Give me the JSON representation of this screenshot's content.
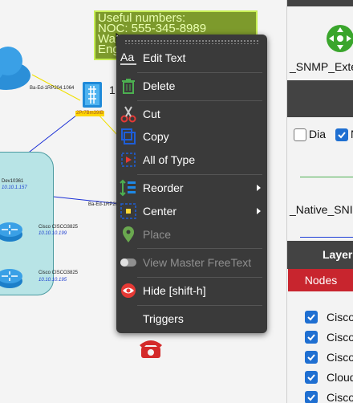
{
  "canvas": {
    "freetext_lines": [
      "Useful numbers:",
      "NOC: 555-345-8989",
      "Wa",
      "Eng"
    ],
    "nodes": [
      {
        "name": "Ba-Ed-1RP204.1064"
      },
      {
        "name": "2Pr7Bm39IB"
      },
      {
        "name": "Dev10361",
        "ip": "10.10.1.157"
      },
      {
        "name": "Ba-Ed-1RP20"
      },
      {
        "name": "Cisco CISCO3825",
        "ip": "10.10.10.199"
      },
      {
        "name": "Cisco CISCO3825",
        "ip": "10.10.10.195"
      }
    ],
    "partial_digit": "1"
  },
  "context_menu": {
    "items": [
      {
        "label": "Edit Text",
        "icon": "text-format-icon",
        "disabled": false
      },
      {
        "label": "Delete",
        "icon": "trash-icon",
        "disabled": false
      },
      {
        "label": "Cut",
        "icon": "scissors-icon",
        "disabled": false
      },
      {
        "label": "Copy",
        "icon": "copy-icon",
        "disabled": false
      },
      {
        "label": "All of Type",
        "icon": "select-type-icon",
        "disabled": false
      },
      {
        "label": "Reorder",
        "icon": "reorder-icon",
        "disabled": false,
        "submenu": true
      },
      {
        "label": "Center",
        "icon": "center-icon",
        "disabled": false,
        "submenu": true
      },
      {
        "label": "Place",
        "icon": "map-pin-icon",
        "disabled": true
      },
      {
        "label": "View Master FreeText",
        "icon": "toggle-icon",
        "disabled": true
      },
      {
        "label": "Hide [shift-h]",
        "icon": "hide-icon",
        "disabled": false
      },
      {
        "label": "Triggers",
        "icon": "",
        "disabled": false
      }
    ]
  },
  "right_panel": {
    "snmp_label": "_SNMP_Exte",
    "dia_label": "Dia",
    "dia_checked": false,
    "second_checked": true,
    "second_label": "N",
    "native_label": "_Native_SNI",
    "layers_title": "Layer",
    "nodes_tab": "Nodes",
    "list_items": [
      "Cisco",
      "Cisco",
      "Cisco",
      "Cloud",
      "Cisco"
    ],
    "accent_color": "#c8252e",
    "checkbox_color": "#1f6fd1"
  }
}
